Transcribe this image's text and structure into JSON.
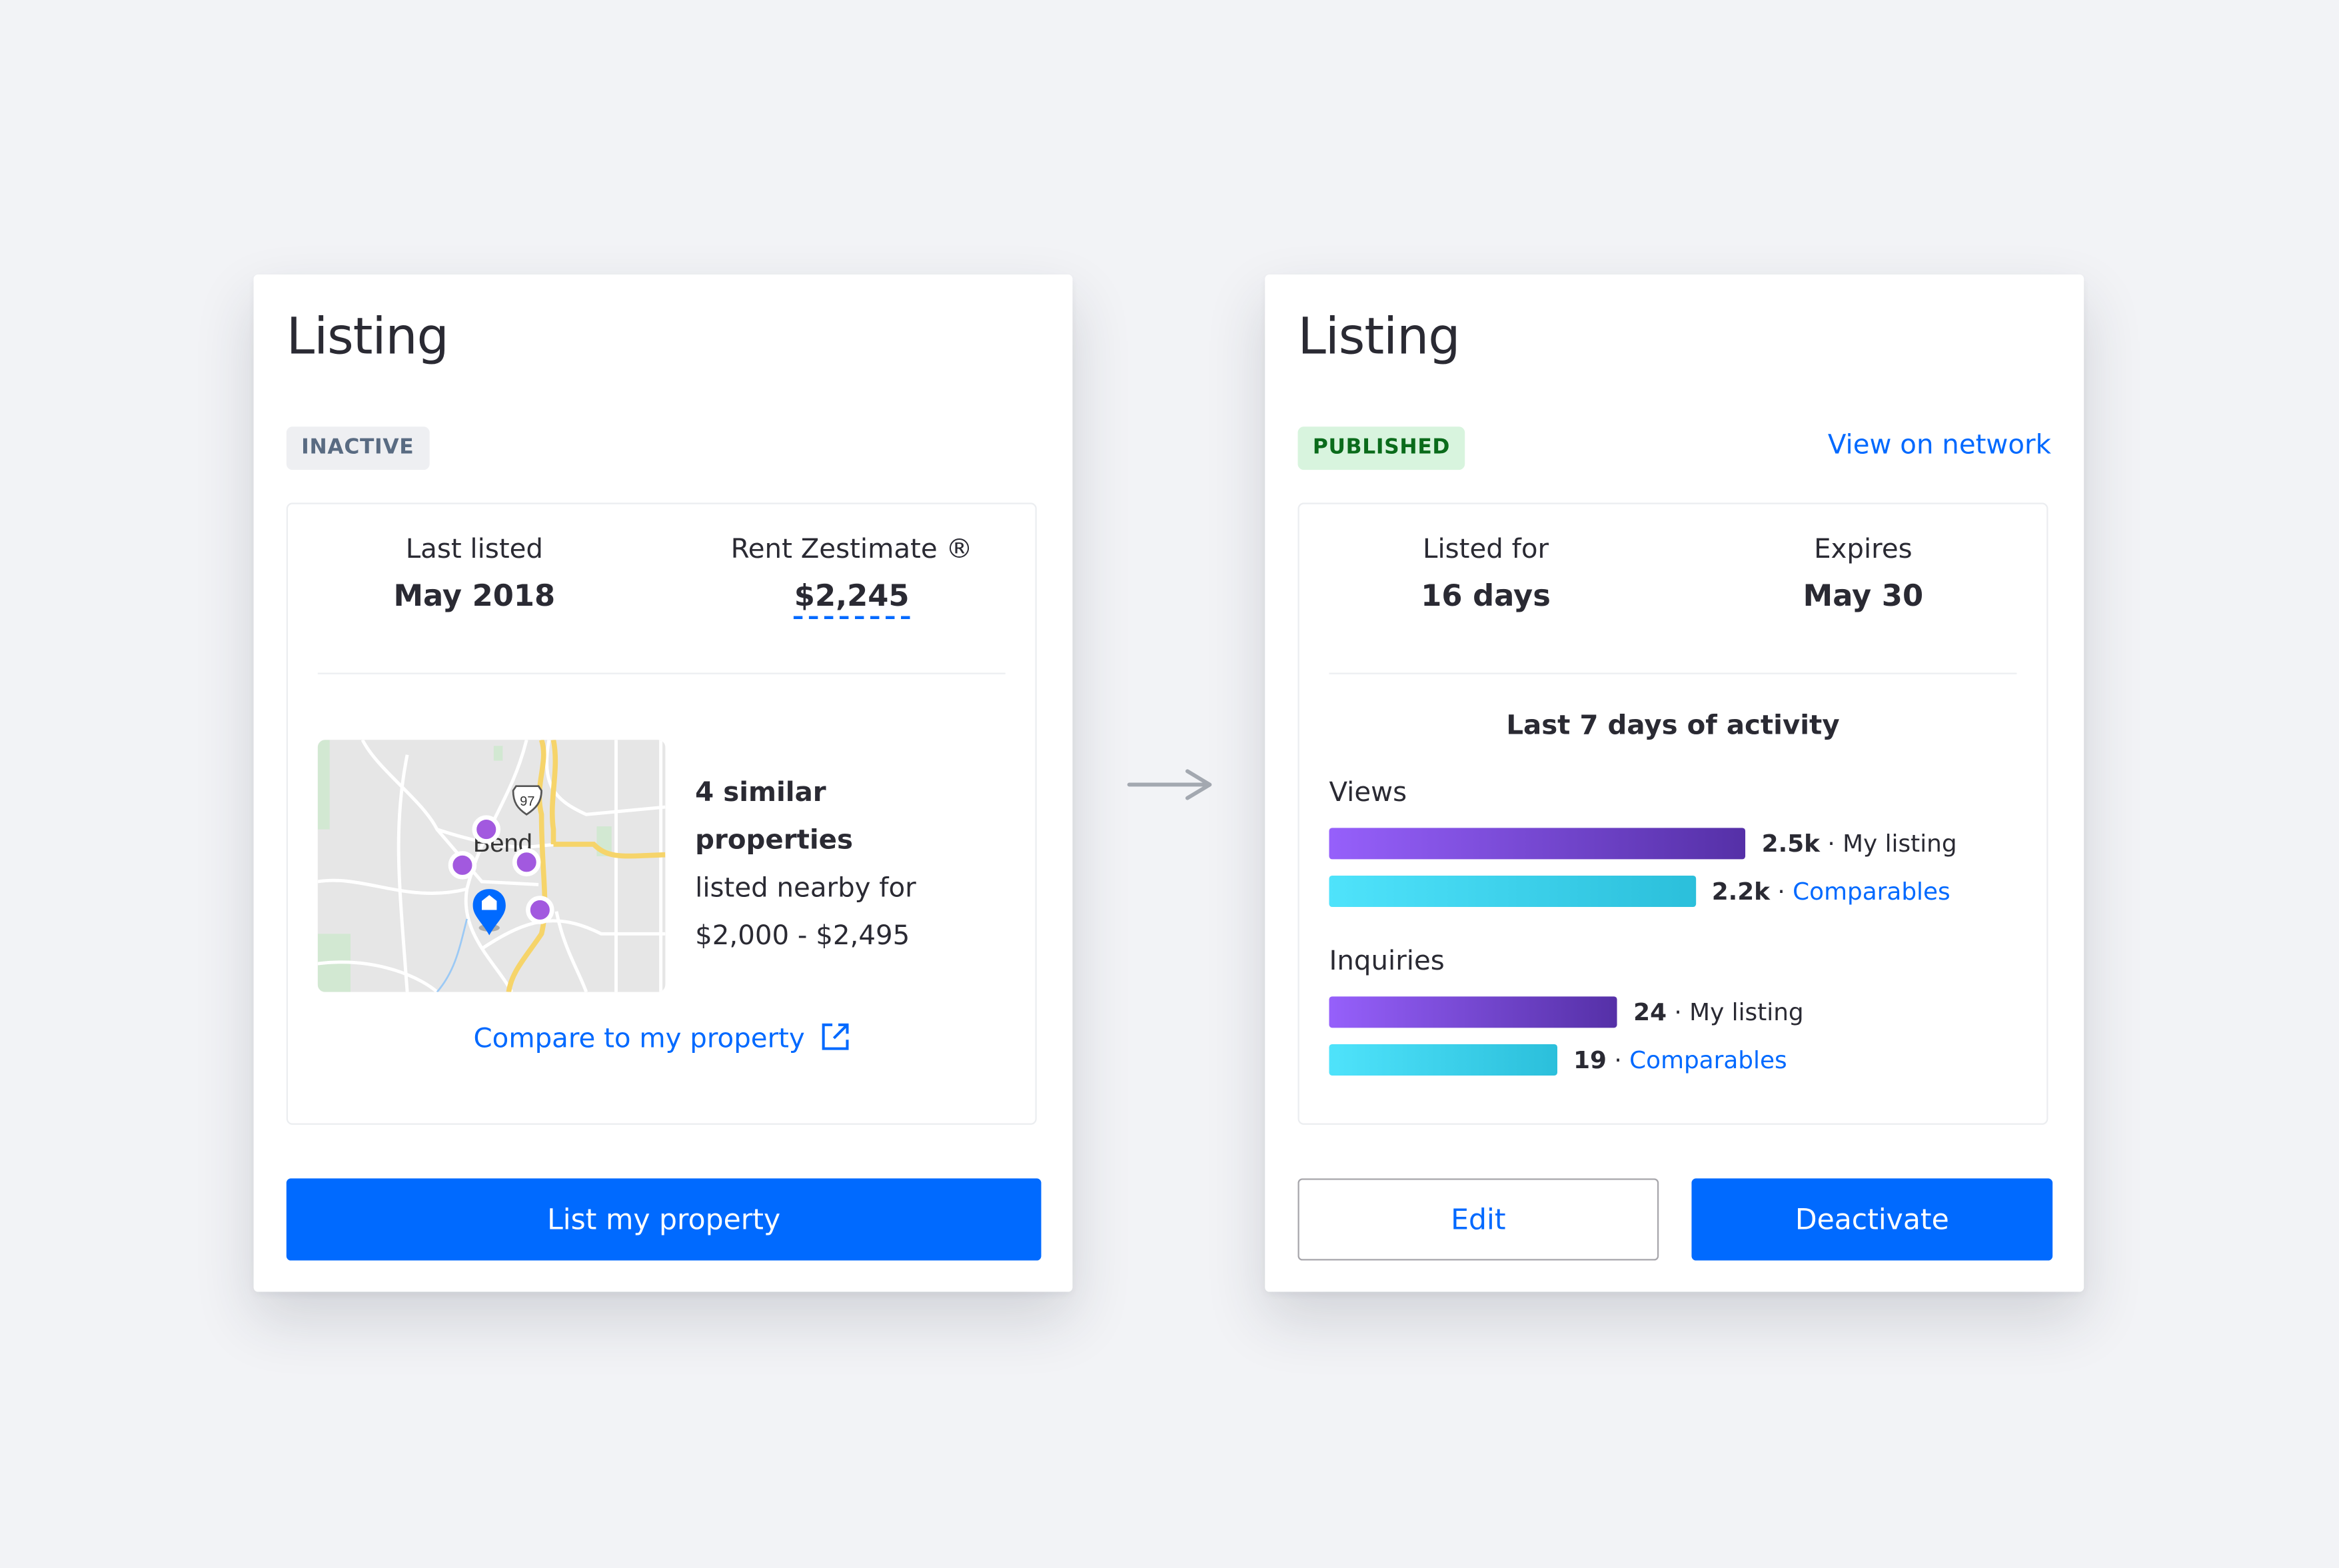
{
  "before": {
    "title": "Listing",
    "status_badge": "INACTIVE",
    "stats": [
      {
        "label": "Last listed",
        "value": "May 2018"
      },
      {
        "label": "Rent Zestimate ®",
        "value": "$2,245"
      }
    ],
    "map": {
      "city_label": "Bend",
      "highway_shield": "97",
      "comparable_markers": 4,
      "home_marker_icon": "home-pin-icon"
    },
    "similar": {
      "line1": "4 similar",
      "line2": "properties",
      "line3": "listed nearby for",
      "line4": "$2,000 - $2,495"
    },
    "compare_link": "Compare to my property",
    "compare_icon": "external-link-icon",
    "primary_button": "List my property"
  },
  "transition_icon": "arrow-right-icon",
  "after": {
    "title": "Listing",
    "status_badge": "PUBLISHED",
    "view_link": "View on network",
    "stats": [
      {
        "label": "Listed for",
        "value": "16 days"
      },
      {
        "label": "Expires",
        "value": "May 30"
      }
    ],
    "activity_title": "Last 7 days of activity",
    "edit_button": "Edit",
    "deactivate_button": "Deactivate"
  },
  "colors": {
    "accent": "#006aff",
    "inactive_badge_bg": "#eeeff2",
    "inactive_badge_text": "#596b82",
    "published_badge_bg": "#d8f4de",
    "published_badge_text": "#0a6b1b",
    "my_listing_bar": "#7a48e0",
    "comparables_bar": "#3dd2ee"
  },
  "chart_data": {
    "type": "bar",
    "title": "Last 7 days of activity",
    "orientation": "horizontal",
    "groups": [
      {
        "name": "Views",
        "items": [
          {
            "series": "My listing",
            "value": 2500,
            "display": "2.5k",
            "label": "My listing",
            "is_link": false
          },
          {
            "series": "Comparables",
            "value": 2200,
            "display": "2.2k",
            "label": "Comparables",
            "is_link": true
          }
        ]
      },
      {
        "name": "Inquiries",
        "items": [
          {
            "series": "My listing",
            "value": 24,
            "display": "24",
            "label": "My listing",
            "is_link": false
          },
          {
            "series": "Comparables",
            "value": 19,
            "display": "19",
            "label": "Comparables",
            "is_link": true
          }
        ]
      }
    ],
    "separator": "·"
  }
}
